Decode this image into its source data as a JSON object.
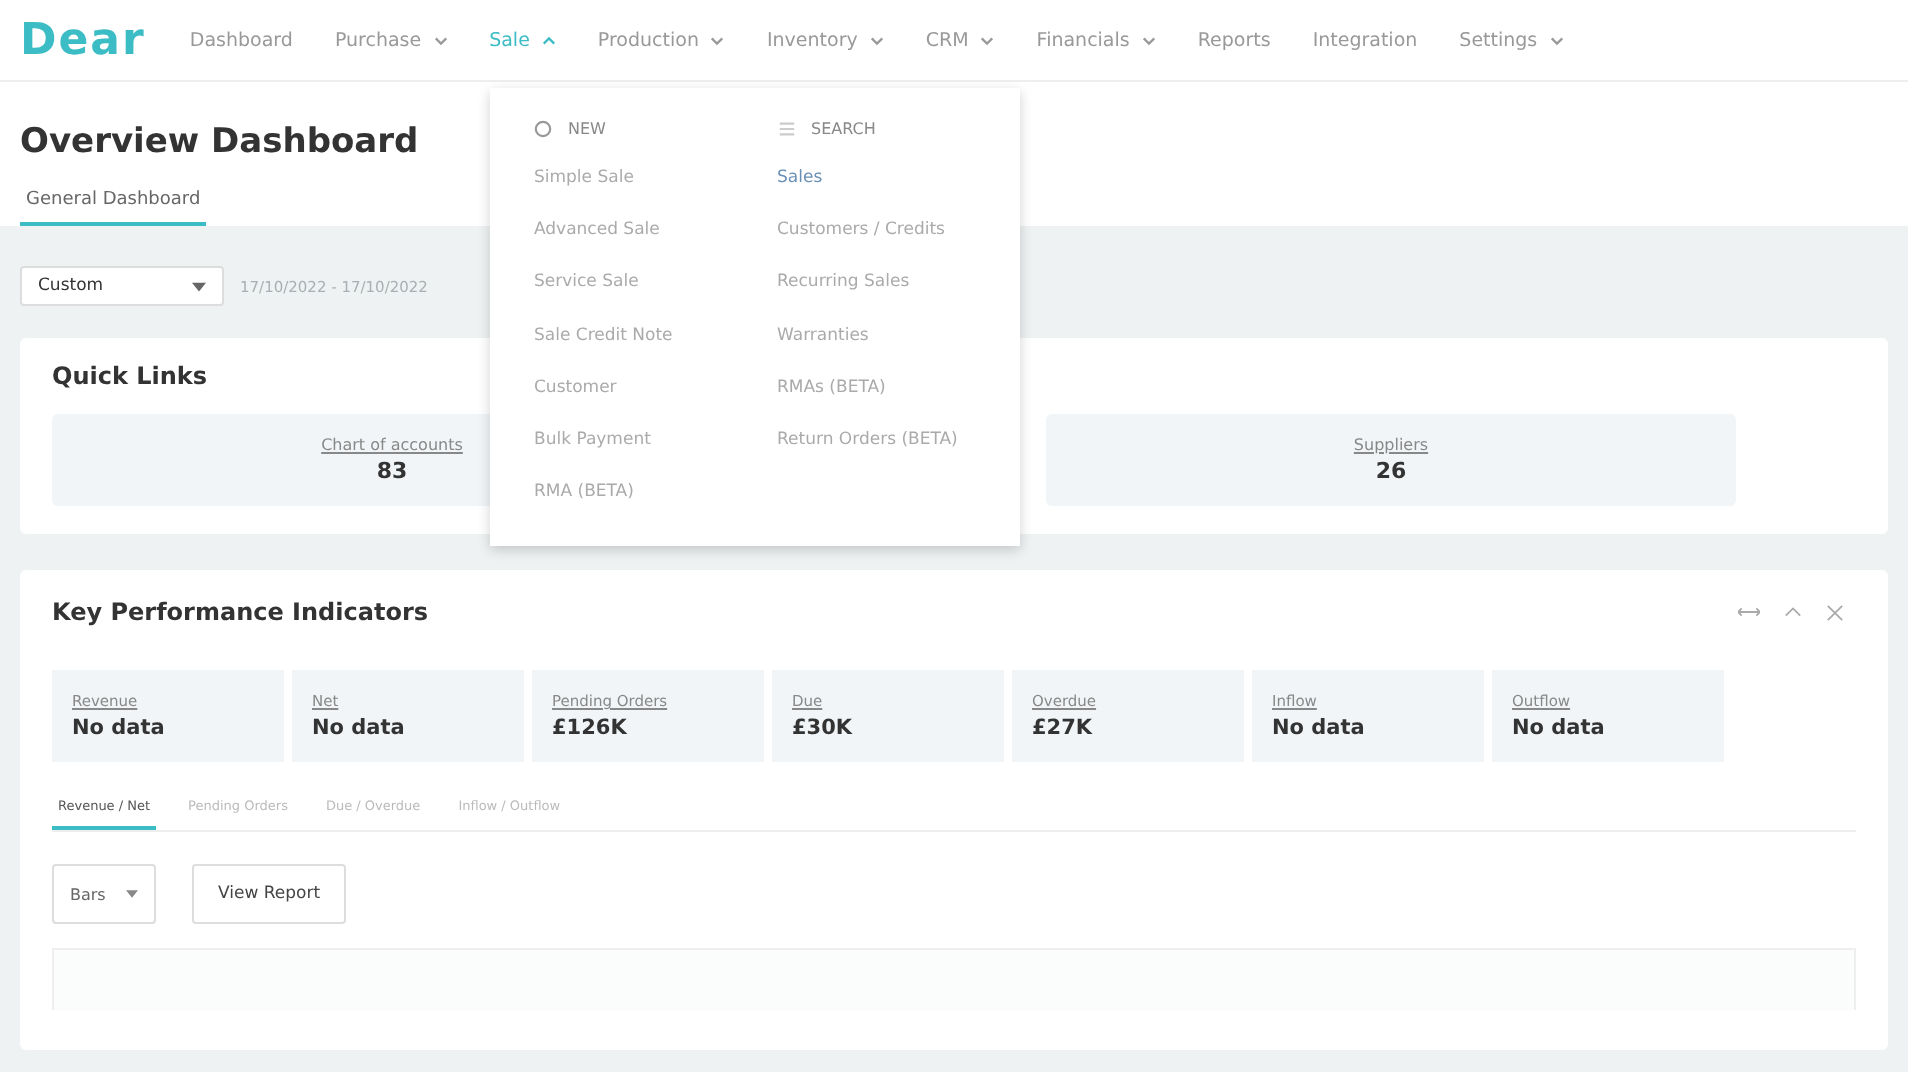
{
  "nav": {
    "logo": "Dear",
    "items": [
      {
        "label": "Dashboard",
        "dropdown": false,
        "selected": false
      },
      {
        "label": "Purchase",
        "dropdown": true,
        "selected": false
      },
      {
        "label": "Sale",
        "dropdown": true,
        "selected": true
      },
      {
        "label": "Production",
        "dropdown": true,
        "selected": false
      },
      {
        "label": "Inventory",
        "dropdown": true,
        "selected": false
      },
      {
        "label": "CRM",
        "dropdown": true,
        "selected": false
      },
      {
        "label": "Financials",
        "dropdown": true,
        "selected": false
      },
      {
        "label": "Reports",
        "dropdown": false,
        "selected": false
      },
      {
        "label": "Integration",
        "dropdown": false,
        "selected": false
      },
      {
        "label": "Settings",
        "dropdown": true,
        "selected": false
      }
    ]
  },
  "page_title": "Overview Dashboard",
  "tabs": [
    {
      "label": "General Dashboard",
      "selected": true
    }
  ],
  "filter": {
    "period": "Custom",
    "date_range": "17/10/2022 - 17/10/2022"
  },
  "quick_links": {
    "title": "Quick Links",
    "tiles": [
      {
        "label": "Chart of accounts",
        "value": "83"
      },
      {
        "label": "Suppliers",
        "value": "26"
      }
    ]
  },
  "menu": {
    "columns": [
      {
        "heading": "NEW",
        "kind": "new",
        "items": [
          {
            "label": "Simple Sale",
            "hover": false
          },
          {
            "label": "Advanced Sale",
            "hover": false
          },
          {
            "label": "Service Sale",
            "hover": false
          },
          {
            "label": "Sale Credit Note",
            "hover": false
          },
          {
            "label": "Customer",
            "hover": false
          },
          {
            "label": "Bulk Payment",
            "hover": false
          },
          {
            "label": "RMA (BETA)",
            "hover": false
          }
        ]
      },
      {
        "heading": "SEARCH",
        "kind": "search",
        "items": [
          {
            "label": "Sales",
            "hover": true
          },
          {
            "label": "Customers / Credits",
            "hover": false
          },
          {
            "label": "Recurring Sales",
            "hover": false
          },
          {
            "label": "Warranties",
            "hover": false
          },
          {
            "label": "RMAs (BETA)",
            "hover": false
          },
          {
            "label": "Return Orders (BETA)",
            "hover": false
          }
        ]
      }
    ]
  },
  "kpi": {
    "title": "Key Performance Indicators",
    "cards": [
      {
        "label": "Revenue",
        "value": "No data"
      },
      {
        "label": "Net",
        "value": "No data"
      },
      {
        "label": "Pending Orders",
        "value": "£126K"
      },
      {
        "label": "Due",
        "value": "£30K"
      },
      {
        "label": "Overdue",
        "value": "£27K"
      },
      {
        "label": "Inflow",
        "value": "No data"
      },
      {
        "label": "Outflow",
        "value": "No data"
      }
    ],
    "tabs": [
      {
        "label": "Revenue / Net",
        "selected": true
      },
      {
        "label": "Pending Orders",
        "selected": false
      },
      {
        "label": "Due / Overdue",
        "selected": false
      },
      {
        "label": "Inflow / Outflow",
        "selected": false
      }
    ],
    "chart_type": "Bars",
    "report_button": "View Report"
  }
}
